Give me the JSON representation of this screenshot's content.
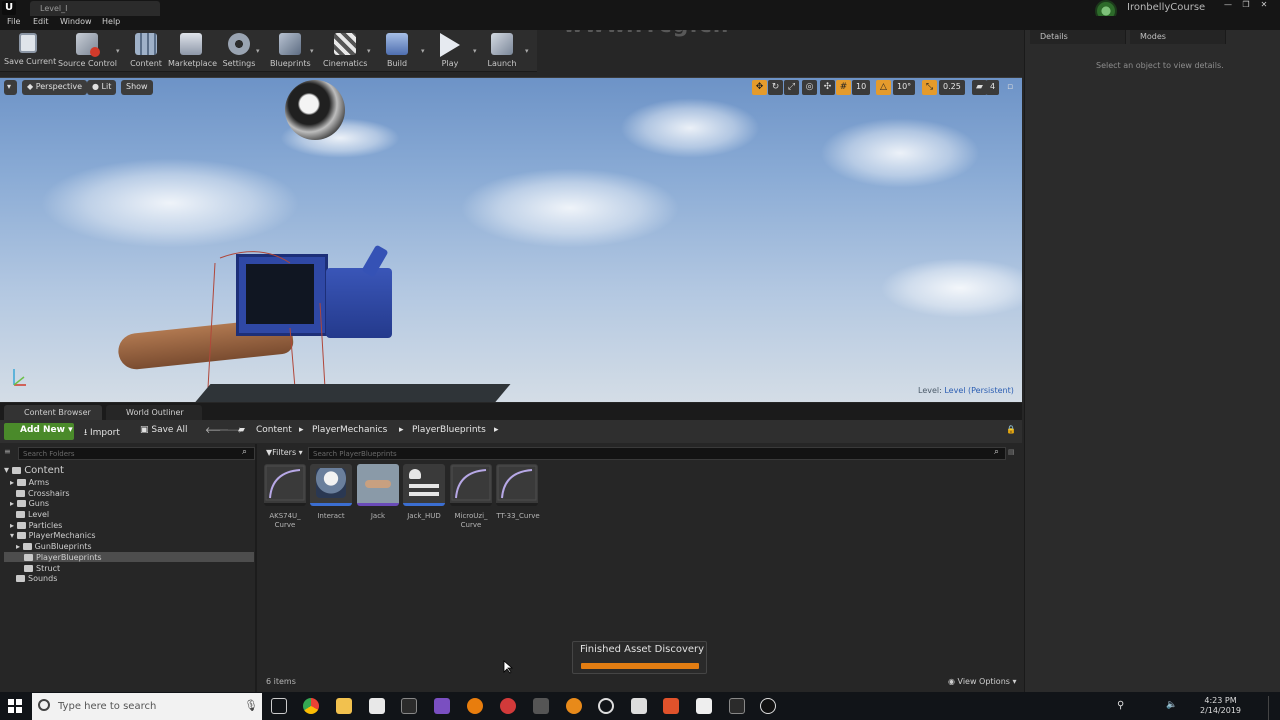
{
  "window": {
    "tab_title": "Level_I",
    "user": "IronbellyCourse",
    "controls": [
      "—",
      "❐",
      "✕"
    ]
  },
  "menu": [
    "File",
    "Edit",
    "Window",
    "Help"
  ],
  "toolbar": {
    "buttons": [
      {
        "label": "Save Current"
      },
      {
        "label": "Source Control"
      },
      {
        "label": "Content"
      },
      {
        "label": "Marketplace"
      },
      {
        "label": "Settings"
      },
      {
        "label": "Blueprints"
      },
      {
        "label": "Cinematics"
      },
      {
        "label": "Build"
      },
      {
        "label": "Play"
      },
      {
        "label": "Launch"
      }
    ]
  },
  "right_panel": {
    "tabs": [
      "Details",
      "Modes"
    ],
    "hint": "Select an object to view details."
  },
  "viewport": {
    "view_mode": "Perspective",
    "lighting": "Lit",
    "show": "Show",
    "grid_snap": "10",
    "rotation_snap": "10°",
    "scale_snap": "0.25",
    "camera_speed": "4",
    "level_label": "Level:",
    "level_name": "Level (Persistent)"
  },
  "content_browser": {
    "tabs": [
      "Content Browser",
      "World Outliner"
    ],
    "add_new": "Add New",
    "import": "Import",
    "save_all": "Save All",
    "breadcrumb": [
      "Content",
      "PlayerMechanics",
      "PlayerBlueprints"
    ],
    "search_folders_placeholder": "Search Folders",
    "search_assets_placeholder": "Search PlayerBlueprints",
    "filters": "Filters",
    "folders": [
      {
        "name": "Content"
      },
      {
        "name": "Arms"
      },
      {
        "name": "Crosshairs"
      },
      {
        "name": "Guns"
      },
      {
        "name": "Level"
      },
      {
        "name": "Particles"
      },
      {
        "name": "PlayerMechanics"
      },
      {
        "name": "GunBlueprints"
      },
      {
        "name": "PlayerBlueprints"
      },
      {
        "name": "Struct"
      },
      {
        "name": "Sounds"
      }
    ],
    "assets": [
      {
        "label": "AKS74U_ Curve",
        "icon": "curve-icon"
      },
      {
        "label": "Interact",
        "icon": "blueprint-icon"
      },
      {
        "label": "Jack",
        "icon": "character-icon"
      },
      {
        "label": "Jack_HUD",
        "icon": "widget-icon"
      },
      {
        "label": "MicroUzi_ Curve",
        "icon": "curve-icon"
      },
      {
        "label": "TT-33_Curve",
        "icon": "curve-icon"
      }
    ],
    "item_count": "6 items",
    "view_options": "View Options"
  },
  "notification": {
    "text": "Finished Asset Discovery",
    "progress": 1.0
  },
  "taskbar": {
    "search_placeholder": "Type here to search",
    "time": "4:23 PM",
    "date": "2/14/2019"
  },
  "watermark": "www.rrcg.cn"
}
